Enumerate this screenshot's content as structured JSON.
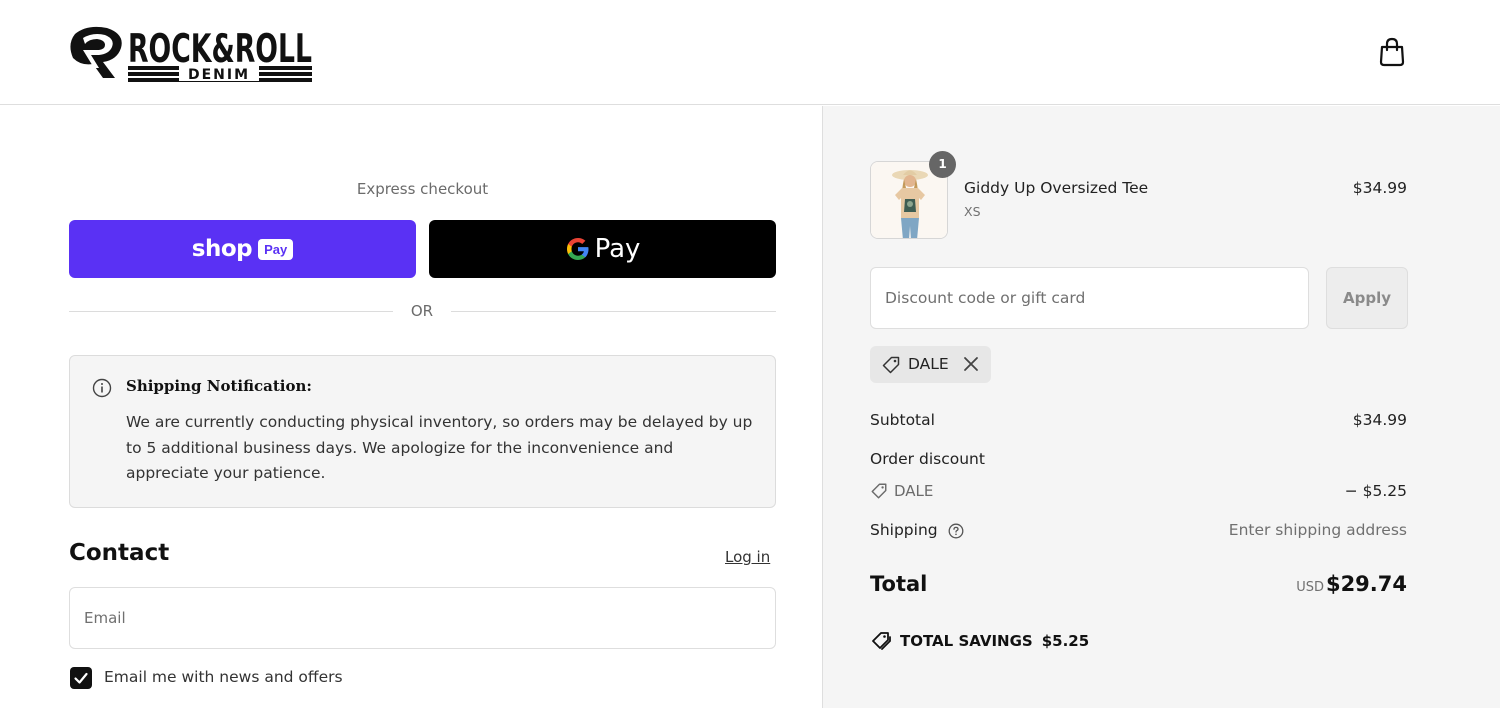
{
  "brand": {
    "logo_text": "ROCK&ROLL",
    "logo_subtext": "DENIM"
  },
  "header": {
    "cart_icon": "shopping-bag-icon"
  },
  "express": {
    "label": "Express checkout",
    "shop_pay_word": "shop",
    "shop_pay_badge": "Pay",
    "gpay_word": "Pay",
    "or_label": "OR"
  },
  "notice": {
    "icon": "info-icon",
    "title": "Shipping Notification:",
    "body": "We are currently conducting physical inventory, so orders may be delayed by up to 5 additional business days. We apologize for the inconvenience and appreciate your patience."
  },
  "contact": {
    "title": "Contact",
    "login_label": "Log in",
    "email_placeholder": "Email",
    "newsletter_label": "Email me with news and offers",
    "newsletter_checked": true
  },
  "order": {
    "item": {
      "name": "Giddy Up Oversized Tee",
      "variant": "XS",
      "price": "$34.99",
      "quantity": "1"
    },
    "discount_placeholder": "Discount code or gift card",
    "apply_label": "Apply",
    "applied_code": "DALE",
    "subtotal_label": "Subtotal",
    "subtotal_value": "$34.99",
    "order_discount_label": "Order discount",
    "discount_code_label": "DALE",
    "discount_value": "− $5.25",
    "shipping_label": "Shipping",
    "shipping_value": "Enter shipping address",
    "total_label": "Total",
    "total_currency": "USD",
    "total_value": "$29.74",
    "savings_label": "TOTAL SAVINGS",
    "savings_value": "$5.25"
  },
  "colors": {
    "shop_pay": "#5a31f4",
    "gpay": "#000000",
    "sidebar_bg": "#f5f5f5"
  }
}
